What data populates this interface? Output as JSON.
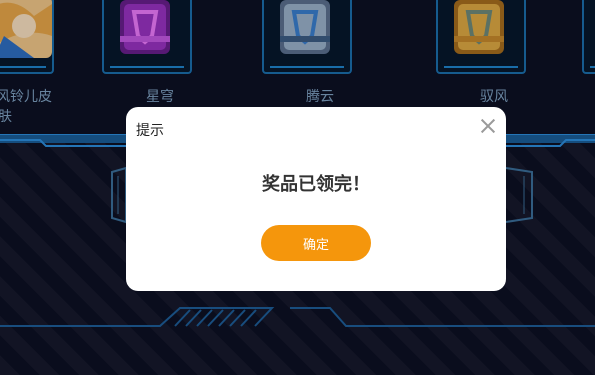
{
  "prizes": [
    {
      "name": "风铃儿皮",
      "name_line2": "肤",
      "icon": "anime-character-portrait"
    },
    {
      "name": "星穹",
      "icon": "purple-gem-box-icon",
      "color": "#b23fd6"
    },
    {
      "name": "腾云",
      "icon": "silver-blue-box-icon",
      "color": "#8aa6c6"
    },
    {
      "name": "驭风",
      "icon": "gold-box-icon",
      "color": "#d9a23c"
    }
  ],
  "dialog": {
    "title": "提示",
    "message": "奖品已领完！",
    "confirm_label": "确定",
    "close_icon": "close-icon"
  },
  "colors": {
    "background": "#0d1124",
    "accent_blue": "#1b6fae",
    "confirm_button": "#f5960c"
  }
}
